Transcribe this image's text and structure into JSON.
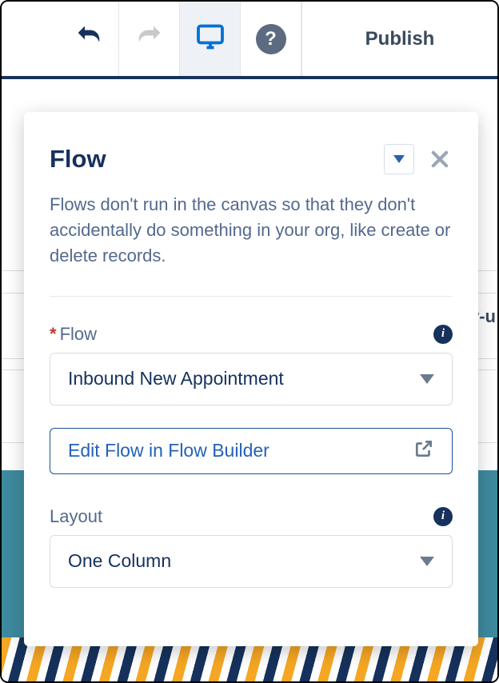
{
  "toolbar": {
    "publish_label": "Publish"
  },
  "panel": {
    "title": "Flow",
    "description": "Flows don't run in the canvas so that they don't accidentally do something in your org, like create or delete records."
  },
  "fields": {
    "flow": {
      "label": "Flow",
      "value": "Inbound New Appointment"
    },
    "edit_link": "Edit Flow in Flow Builder",
    "layout": {
      "label": "Layout",
      "value": "One Column"
    }
  },
  "background": {
    "peek_text": "r-u"
  }
}
